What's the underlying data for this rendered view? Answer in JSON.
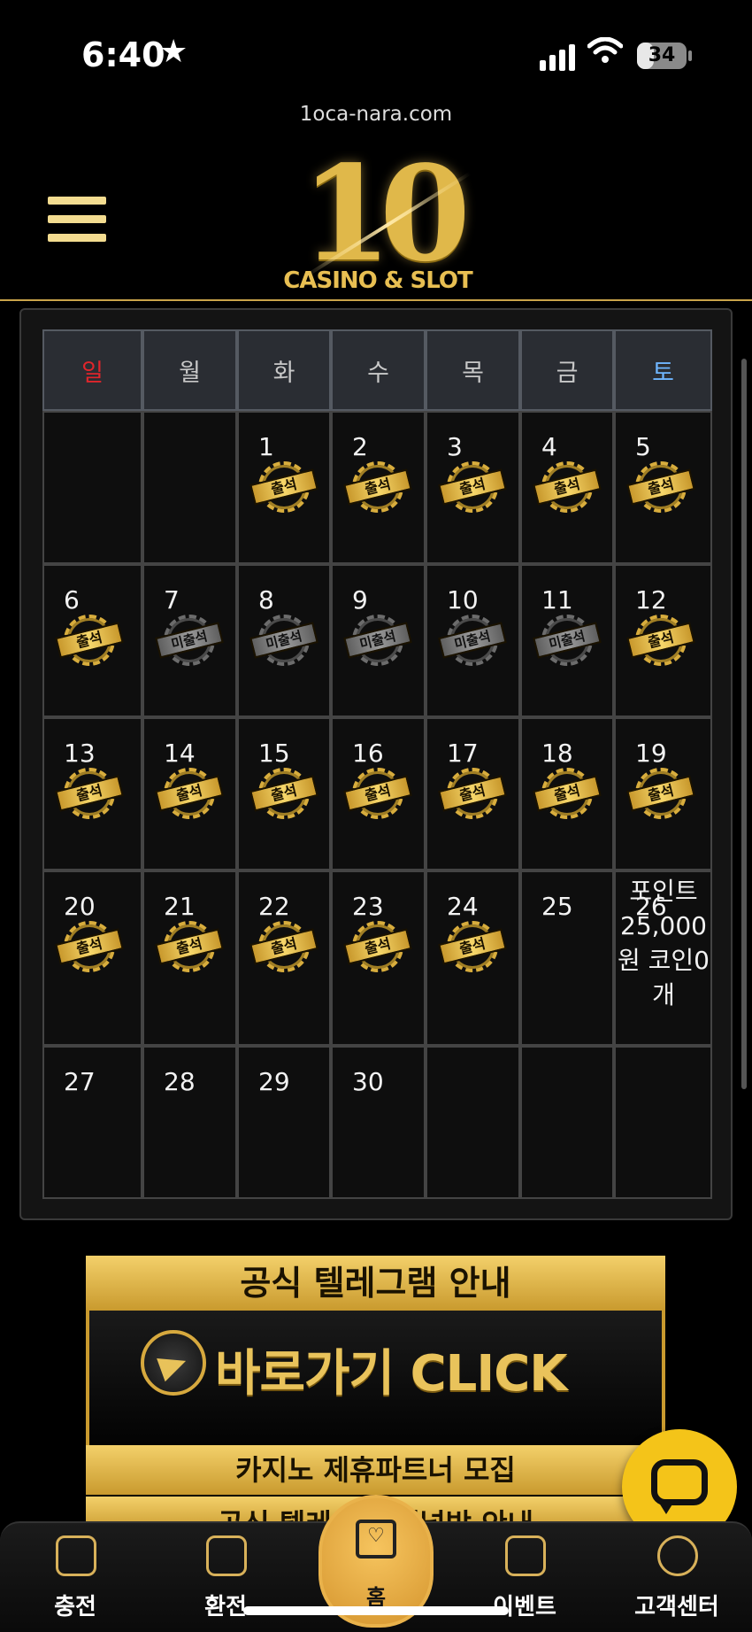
{
  "status_bar": {
    "time": "6:40",
    "battery": "34"
  },
  "browser": {
    "url": "1oca-nara.com"
  },
  "header": {
    "logo_number": "10",
    "logo_subtitle": "CASINO & SLOT"
  },
  "calendar": {
    "weekdays": [
      "일",
      "월",
      "화",
      "수",
      "목",
      "금",
      "토"
    ],
    "weekday_colors": [
      "#e0252b",
      "#c8c8c8",
      "#c8c8c8",
      "#c8c8c8",
      "#c8c8c8",
      "#c8c8c8",
      "#6fb6ff"
    ],
    "attended_label": "출석",
    "missed_label": "미출석",
    "weeks": [
      [
        {
          "day": "",
          "stamp": "none"
        },
        {
          "day": "",
          "stamp": "none"
        },
        {
          "day": "1",
          "stamp": "attended"
        },
        {
          "day": "2",
          "stamp": "attended"
        },
        {
          "day": "3",
          "stamp": "attended"
        },
        {
          "day": "4",
          "stamp": "attended"
        },
        {
          "day": "5",
          "stamp": "attended"
        }
      ],
      [
        {
          "day": "6",
          "stamp": "attended"
        },
        {
          "day": "7",
          "stamp": "missed"
        },
        {
          "day": "8",
          "stamp": "missed"
        },
        {
          "day": "9",
          "stamp": "missed"
        },
        {
          "day": "10",
          "stamp": "missed"
        },
        {
          "day": "11",
          "stamp": "missed"
        },
        {
          "day": "12",
          "stamp": "attended"
        }
      ],
      [
        {
          "day": "13",
          "stamp": "attended"
        },
        {
          "day": "14",
          "stamp": "attended"
        },
        {
          "day": "15",
          "stamp": "attended"
        },
        {
          "day": "16",
          "stamp": "attended"
        },
        {
          "day": "17",
          "stamp": "attended"
        },
        {
          "day": "18",
          "stamp": "attended"
        },
        {
          "day": "19",
          "stamp": "attended"
        }
      ],
      [
        {
          "day": "20",
          "stamp": "attended"
        },
        {
          "day": "21",
          "stamp": "attended"
        },
        {
          "day": "22",
          "stamp": "attended"
        },
        {
          "day": "23",
          "stamp": "attended"
        },
        {
          "day": "24",
          "stamp": "attended"
        },
        {
          "day": "25",
          "stamp": "none"
        },
        {
          "day": "26",
          "stamp": "none"
        }
      ],
      [
        {
          "day": "27",
          "stamp": "none"
        },
        {
          "day": "28",
          "stamp": "none"
        },
        {
          "day": "29",
          "stamp": "none"
        },
        {
          "day": "30",
          "stamp": "none"
        },
        {
          "day": "",
          "stamp": "none"
        },
        {
          "day": "",
          "stamp": "none"
        },
        {
          "day": "",
          "stamp": "none"
        }
      ]
    ],
    "points_overlay": "포인트 25,000 원 코인0 개"
  },
  "banner": {
    "title": "공식 텔레그램 안내",
    "cta": "바로가기 CLICK",
    "partner": "카지노 제휴파트너 모집",
    "next_line": "공식 텔레그램 채널방 안내"
  },
  "bottom_nav": {
    "charge": "충전",
    "exchange": "환전",
    "home": "홈",
    "event": "이벤트",
    "support": "고객센터"
  },
  "colors": {
    "accent_gold": "#d8b15a",
    "chat_fab": "#f4c419"
  }
}
